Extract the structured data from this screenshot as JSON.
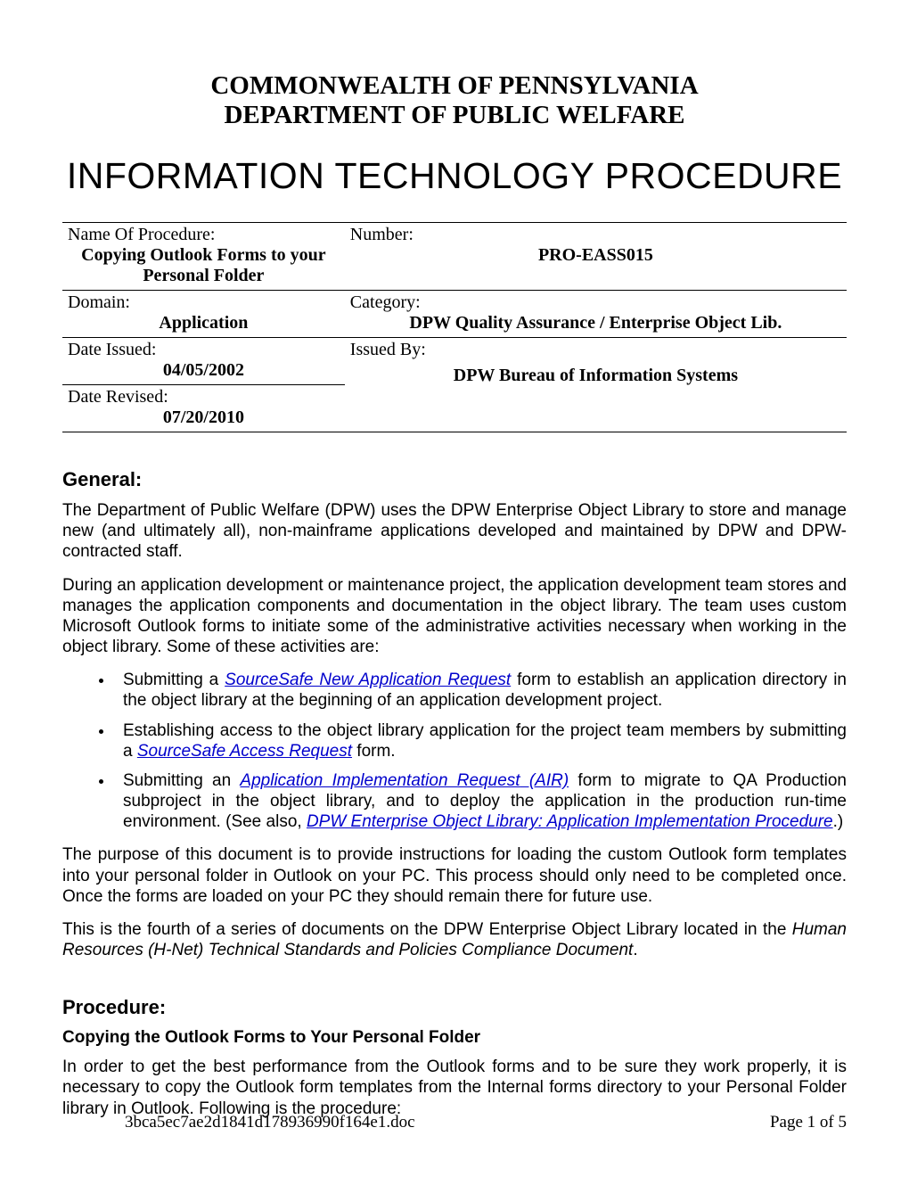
{
  "header": {
    "line1": "COMMONWEALTH OF PENNSYLVANIA",
    "line2": "DEPARTMENT OF PUBLIC WELFARE",
    "title": "INFORMATION TECHNOLOGY PROCEDURE"
  },
  "meta": {
    "name_label": "Name Of Procedure:",
    "name_value": "Copying Outlook Forms to your Personal Folder",
    "number_label": "Number:",
    "number_value": "PRO-EASS015",
    "domain_label": "Domain:",
    "domain_value": "Application",
    "category_label": "Category:",
    "category_value": "DPW Quality Assurance / Enterprise Object  Lib.",
    "issued_label": "Date Issued:",
    "issued_value": "04/05/2002",
    "revised_label": "Date Revised:",
    "revised_value": "07/20/2010",
    "issuedby_label": "Issued By:",
    "issuedby_value": "DPW Bureau of Information Systems"
  },
  "sections": {
    "general_heading": "General:",
    "general_p1": "The Department of Public Welfare (DPW) uses the DPW Enterprise Object Library to store and manage new (and ultimately all), non-mainframe applications developed and maintained by DPW and DPW-contracted staff.",
    "general_p2": "During an application development or maintenance project, the application development team stores and manages the application components and documentation in the object library. The team uses custom Microsoft Outlook forms to initiate some of the administrative activities necessary when working in the object library. Some of these activities are:",
    "bullet1_pre": "Submitting a ",
    "bullet1_link": "SourceSafe New Application Request",
    "bullet1_post": " form to establish an application directory in the object library at the beginning of an application development project.",
    "bullet2_pre": "Establishing access to the object library application for the project team members by submitting a ",
    "bullet2_link": "SourceSafe Access Request",
    "bullet2_post": " form.",
    "bullet3_pre": "Submitting an ",
    "bullet3_link": "Application Implementation Request",
    "bullet3_link_suffix": " (AIR)",
    "bullet3_mid": " form to migrate to QA Production subproject in the object library, and to deploy the application in the production run-time environment. (See also, ",
    "bullet3_link2": "DPW Enterprise Object Library: Application Implementation Procedure",
    "bullet3_post": ".)",
    "general_p3": "The purpose of this document is to provide instructions for loading the custom Outlook form templates into your personal folder in Outlook on your PC. This process should only need to be completed once. Once the forms are loaded on your PC they should remain there for future use.",
    "general_p4_pre": "This is the fourth of a series of documents on the DPW Enterprise Object Library located in the ",
    "general_p4_italic": "Human Resources (H-Net) Technical Standards and Policies Compliance Document",
    "general_p4_post": ".",
    "procedure_heading": "Procedure:",
    "procedure_sub": "Copying the Outlook Forms to Your Personal Folder",
    "procedure_p1": "In order to get the best performance from the Outlook forms and to be sure they work properly, it is necessary to copy the Outlook form templates from the Internal forms directory to your Personal Folder library in Outlook. Following is the procedure:"
  },
  "footer": {
    "filename": "3bca5ec7ae2d1841d178936990f164e1.doc",
    "page": "Page 1 of 5"
  }
}
